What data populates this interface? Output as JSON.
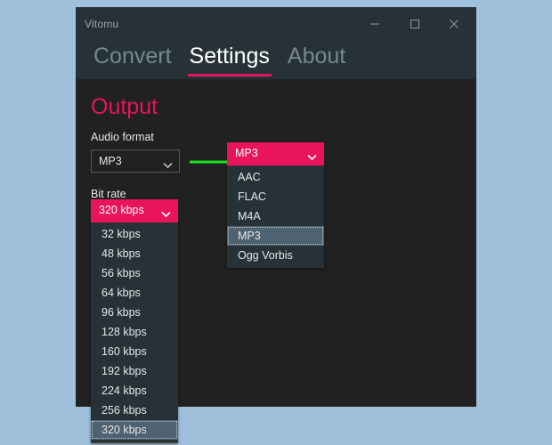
{
  "window": {
    "title": "Vitomu",
    "controls": [
      {
        "name": "minimize-button",
        "label": "Minimize"
      },
      {
        "name": "maximize-button",
        "label": "Maximize"
      },
      {
        "name": "close-button",
        "label": "Close"
      }
    ]
  },
  "tabs": [
    {
      "label": "Convert",
      "active": false
    },
    {
      "label": "Settings",
      "active": true
    },
    {
      "label": "About",
      "active": false
    }
  ],
  "settings": {
    "heading": "Output",
    "audio_format": {
      "label": "Audio format",
      "value": "MP3",
      "options": [
        "AAC",
        "FLAC",
        "M4A",
        "MP3",
        "Ogg Vorbis"
      ],
      "selected": "MP3"
    },
    "bit_rate": {
      "label": "Bit rate",
      "value": "320 kbps",
      "options": [
        "32 kbps",
        "48 kbps",
        "56 kbps",
        "64 kbps",
        "96 kbps",
        "128 kbps",
        "160 kbps",
        "192 kbps",
        "224 kbps",
        "256 kbps",
        "320 kbps"
      ],
      "selected": "320 kbps"
    }
  },
  "annotation": {
    "arrow": "green-right-arrow"
  },
  "colors": {
    "accent_pink": "#e8145c",
    "window_chrome": "#263238",
    "content_bg": "#212121",
    "desktop_bg": "#9fbfdb",
    "highlight": "#4e6272",
    "arrow_green": "#1fe01f"
  }
}
